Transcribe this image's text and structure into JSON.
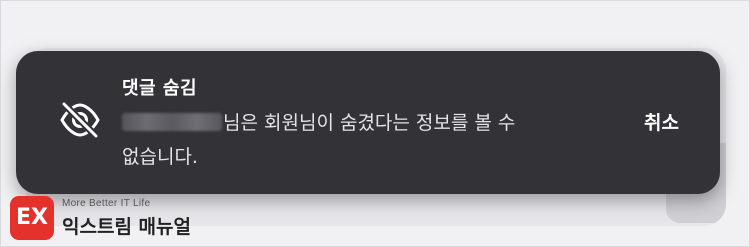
{
  "toast": {
    "icon": "eye-off-icon",
    "title": "댓글 숨김",
    "message_line1": "님은 회원님이 숨겼다는 정보를 볼 수",
    "message_line2": "없습니다.",
    "cancel_label": "취소"
  },
  "watermark": {
    "logo_letters": "EX",
    "tagline": "More Better IT Life",
    "name": "익스트림 매뉴얼",
    "brand_color": "#e4312c"
  },
  "colors": {
    "toast_background": "#323237",
    "page_background": "#f1f1f3"
  }
}
